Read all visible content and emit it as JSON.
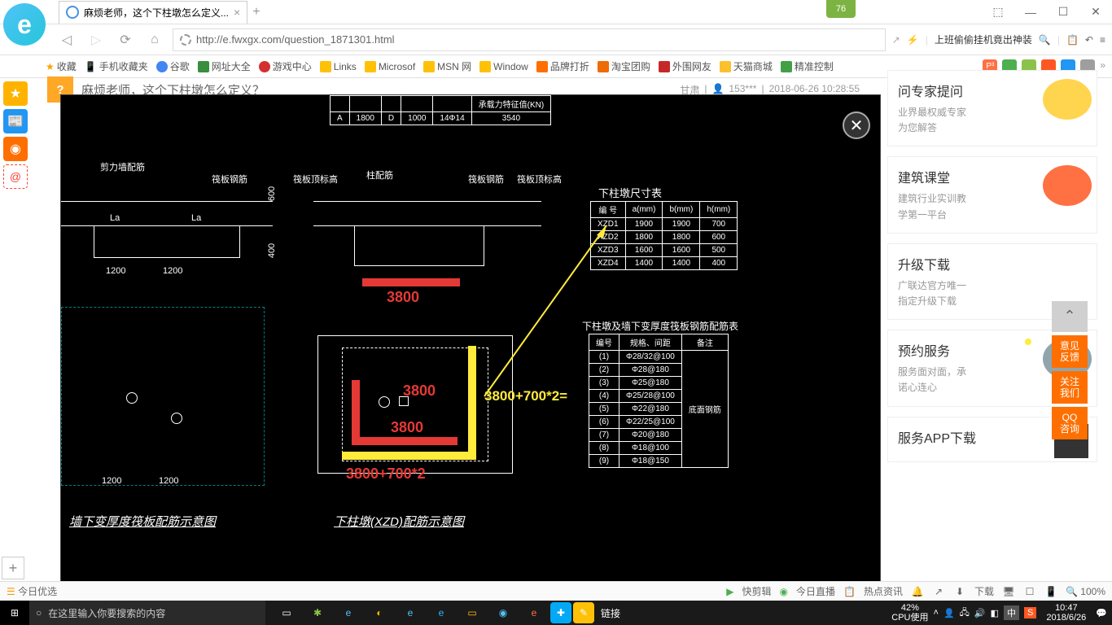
{
  "window": {
    "tab_title": "麻烦老师，这个下柱墩怎么定义...",
    "score": "76"
  },
  "addressbar": {
    "url": "http://e.fwxgx.com/question_1871301.html",
    "right_prompt": "上班偷偷挂机竟出神装"
  },
  "bookmarks": [
    "收藏",
    "手机收藏夹",
    "谷歌",
    "网址大全",
    "游戏中心",
    "Links",
    "Microsof",
    "MSN 网",
    "Window",
    "品牌打折",
    "淘宝团购",
    "外围网友",
    "天猫商城",
    "精准控制"
  ],
  "page": {
    "title": "麻烦老师，这个下柱墩怎么定义？",
    "meta_loc": "甘肃",
    "meta_user": "153***",
    "meta_time": "2018-06-26 10:28:55"
  },
  "cad": {
    "top_table_h": "承载力特征值(KN)",
    "top_row": [
      "A",
      "1800",
      "D",
      "1000",
      "14Φ14",
      "3540"
    ],
    "size_table_title": "下柱墩尺寸表",
    "size_headers": [
      "编  号",
      "a(mm)",
      "b(mm)",
      "h(mm)"
    ],
    "size_rows": [
      [
        "XZD1",
        "1900",
        "1900",
        "700"
      ],
      [
        "XZD2",
        "1800",
        "1800",
        "600"
      ],
      [
        "XZD3",
        "1600",
        "1600",
        "500"
      ],
      [
        "XZD4",
        "1400",
        "1400",
        "400"
      ]
    ],
    "rebar_table_title": "下柱墩及墙下变厚度筏板钢筋配筋表",
    "rebar_headers": [
      "编号",
      "规格、间距",
      "备注"
    ],
    "rebar_rows": [
      [
        "(1)",
        "Φ28/32@100",
        ""
      ],
      [
        "(2)",
        "Φ28@180",
        ""
      ],
      [
        "(3)",
        "Φ25@180",
        ""
      ],
      [
        "(4)",
        "Φ25/28@100",
        ""
      ],
      [
        "(5)",
        "Φ22@180",
        "底面钢筋"
      ],
      [
        "(6)",
        "Φ22/25@100",
        ""
      ],
      [
        "(7)",
        "Φ20@180",
        ""
      ],
      [
        "(8)",
        "Φ18@100",
        ""
      ],
      [
        "(9)",
        "Φ18@150",
        ""
      ]
    ],
    "dim_1200a": "1200",
    "dim_1200b": "1200",
    "dim_600": "600",
    "dim_400": "400",
    "label_la": "La",
    "label_wall": "墙下变厚度筏板配筋示意图",
    "label_xzd": "下柱墩(XZD)配筋示意图",
    "ann_3800": "3800",
    "ann_equation": "3800+700*2=",
    "ann_bottom": "3800+700*2",
    "lbl_jianli": "剪力墙配筋",
    "lbl_fabantop": "筏板顶标高",
    "lbl_fabanrebar": "筏板钢筋",
    "lbl_zhupei": "柱配筋"
  },
  "cards": [
    {
      "title": "问专家提问",
      "desc1": "业界最权威专家",
      "desc2": "为您解答"
    },
    {
      "title": "建筑课堂",
      "desc1": "建筑行业实训教",
      "desc2": "学第一平台"
    },
    {
      "title": "升级下载",
      "desc1": "广联达官方唯一",
      "desc2": "指定升级下载"
    },
    {
      "title": "预约服务",
      "desc1": "服务面对面，承",
      "desc2": "诺心连心"
    },
    {
      "title": "服务APP下载",
      "desc1": "",
      "desc2": ""
    }
  ],
  "float": {
    "b1": "意见\n反馈",
    "b2": "关注\n我们",
    "b3": "QQ\n咨询"
  },
  "statusbar": {
    "today": "今日优选",
    "r1": "快剪辑",
    "r2": "今日直播",
    "r3": "热点资讯",
    "r4": "下载",
    "zoom": "100%"
  },
  "taskbar": {
    "search_ph": "在这里输入你要搜索的内容",
    "link": "链接",
    "cpu_pct": "42%",
    "cpu_lbl": "CPU使用",
    "ime": "中",
    "ime2": "S",
    "time": "10:47",
    "date": "2018/6/26"
  }
}
